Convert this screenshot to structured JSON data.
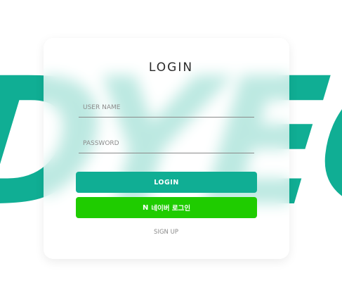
{
  "background": {
    "text": "DYEO",
    "accent_color": "#10ae94"
  },
  "login_card": {
    "title": "LOGIN",
    "username_placeholder": "USER NAME",
    "password_placeholder": "PASSWORD",
    "login_button_label": "LOGIN",
    "naver_icon": "N",
    "naver_button_label": "네이버 로그인",
    "naver_color": "#1fcc00",
    "signup_label": "SIGN UP"
  }
}
